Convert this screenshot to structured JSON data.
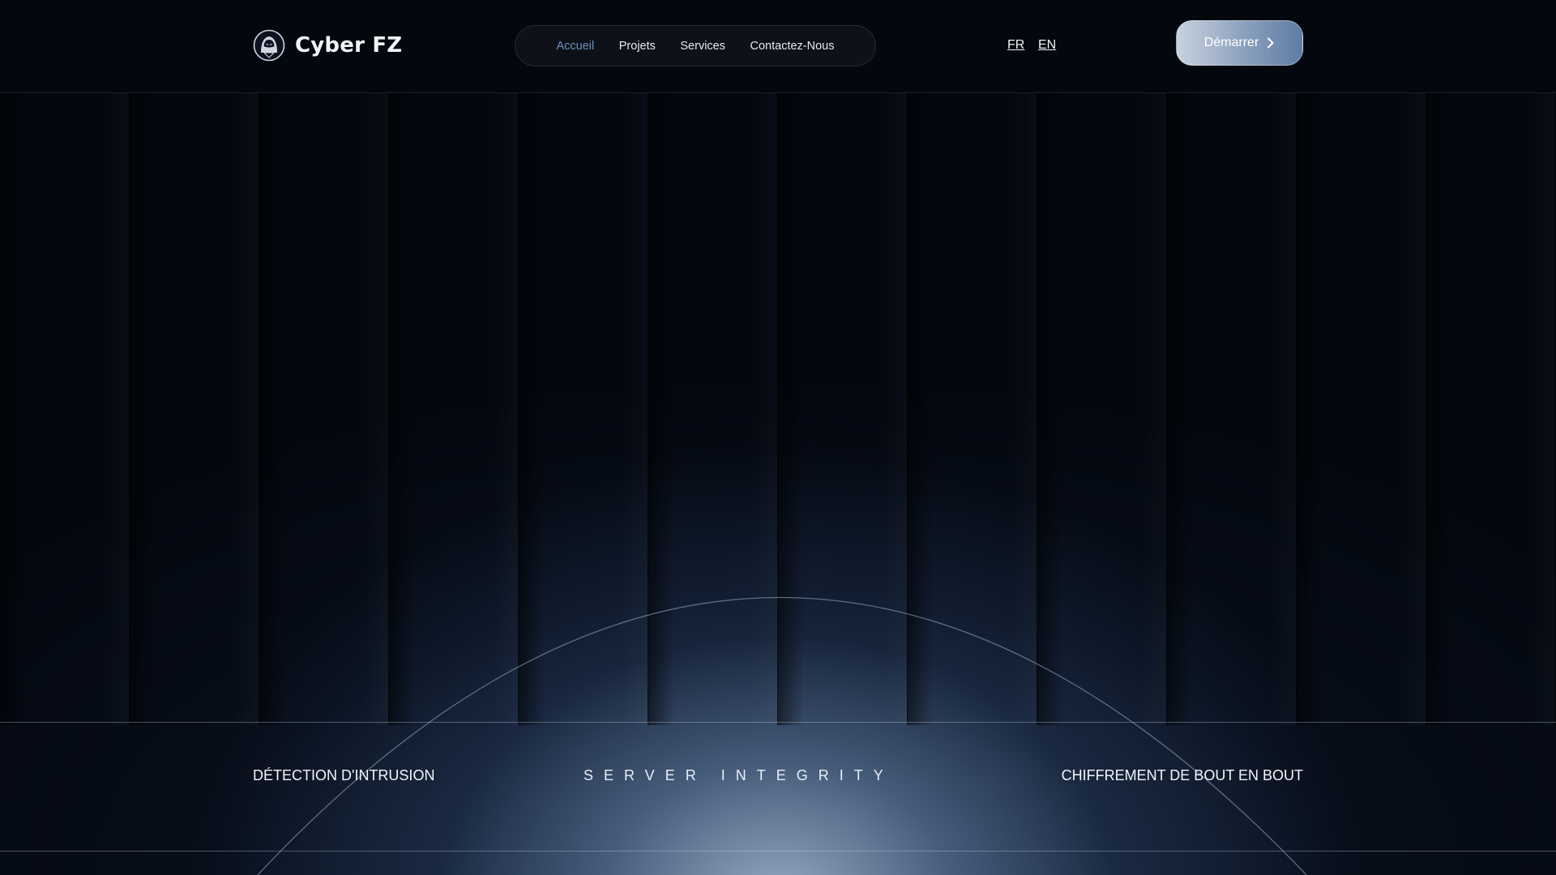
{
  "brand": {
    "name": "Cyber FZ",
    "logo_icon": "hooded-hacker-icon"
  },
  "nav": {
    "items": [
      {
        "label": "Accueil",
        "active": true
      },
      {
        "label": "Projets",
        "active": false
      },
      {
        "label": "Services",
        "active": false
      },
      {
        "label": "Contactez-Nous",
        "active": false
      }
    ],
    "active_color": "#6f8fbf"
  },
  "languages": [
    "FR",
    "EN"
  ],
  "cta": {
    "label": "Démarrer",
    "icon": "chevron-right-icon"
  },
  "band": {
    "left": "DÉTECTION D'INTRUSION",
    "center": "SERVER INTEGRITY",
    "right": "CHIFFREMENT DE BOUT EN BOUT"
  },
  "colors": {
    "background": "#03070f",
    "glow": "#aabed7",
    "cta_gradient": [
      "#c8d2de",
      "#5e7ca7"
    ]
  }
}
